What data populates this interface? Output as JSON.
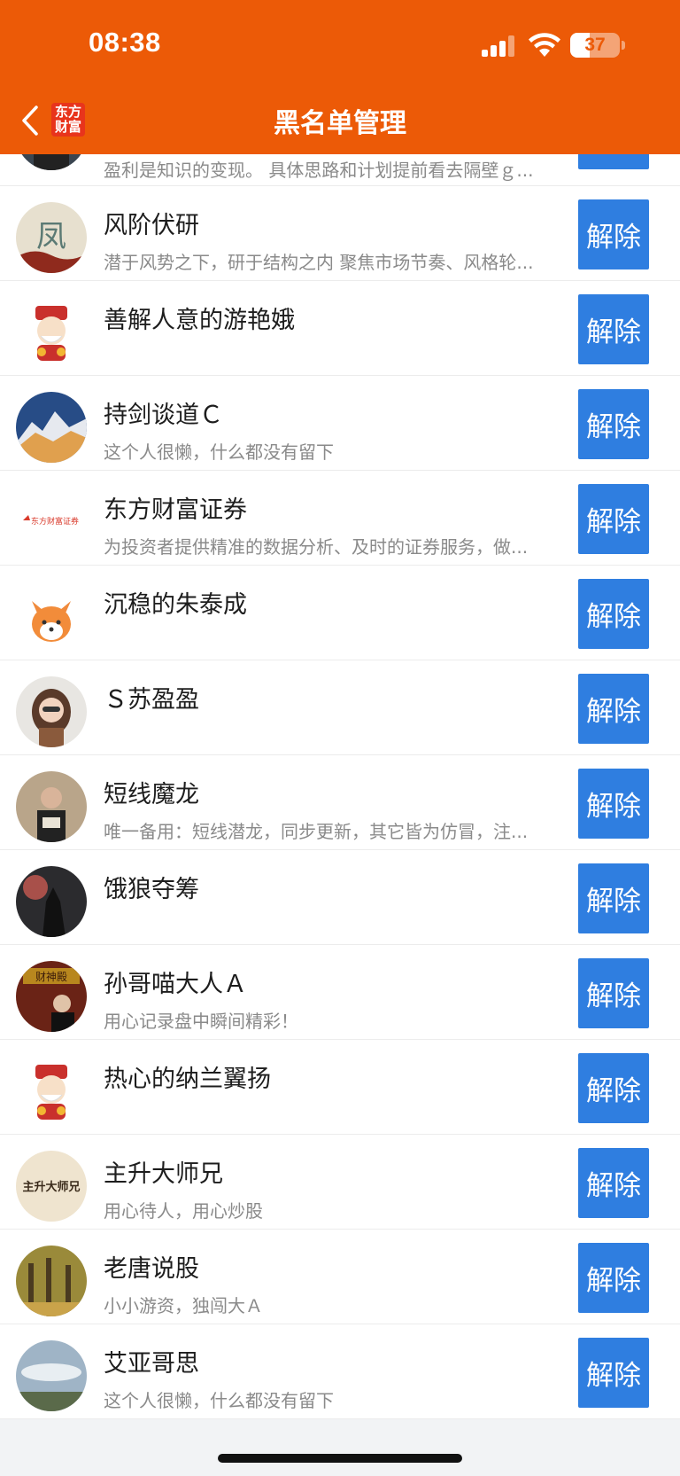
{
  "status_bar": {
    "time": "08:38",
    "battery": "37"
  },
  "header": {
    "logo_line1": "东方",
    "logo_line2": "财富",
    "title": "黑名单管理"
  },
  "colors": {
    "header": "#ec5a07",
    "button": "#2f7ee0"
  },
  "button_label": "解除",
  "rows": [
    {
      "name": "",
      "desc": "盈利是知识的变现。 具体思路和计划提前看去隔壁ｇ..."
    },
    {
      "name": "风阶伏研",
      "desc": "潜于风势之下，研于结构之内 聚焦市场节奏、风格轮..."
    },
    {
      "name": "善解人意的游艳娥",
      "desc": ""
    },
    {
      "name": "持剑谈道Ｃ",
      "desc": "这个人很懒，什么都没有留下"
    },
    {
      "name": "东方财富证券",
      "desc": "为投资者提供精准的数据分析、及时的证券服务，做..."
    },
    {
      "name": "沉稳的朱泰成",
      "desc": ""
    },
    {
      "name": "Ｓ苏盈盈",
      "desc": ""
    },
    {
      "name": "短线魔龙",
      "desc": "唯一备用：短线潜龙，同步更新，其它皆为仿冒，注..."
    },
    {
      "name": "饿狼夺筹",
      "desc": ""
    },
    {
      "name": "孙哥喵大人Ａ",
      "desc": "用心记录盘中瞬间精彩！"
    },
    {
      "name": "热心的纳兰翼扬",
      "desc": ""
    },
    {
      "name": "主升大师兄",
      "desc": "用心待人，用心炒股"
    },
    {
      "name": "老唐说股",
      "desc": "小小游资，独闯大Ａ"
    },
    {
      "name": "艾亚哥思",
      "desc": "这个人很懒，什么都没有留下"
    }
  ],
  "avatars": {
    "row2_text": "凤",
    "row5_text": "东方财富证券",
    "row12_text": "主升大师兄",
    "row10_text": "财神殿"
  }
}
